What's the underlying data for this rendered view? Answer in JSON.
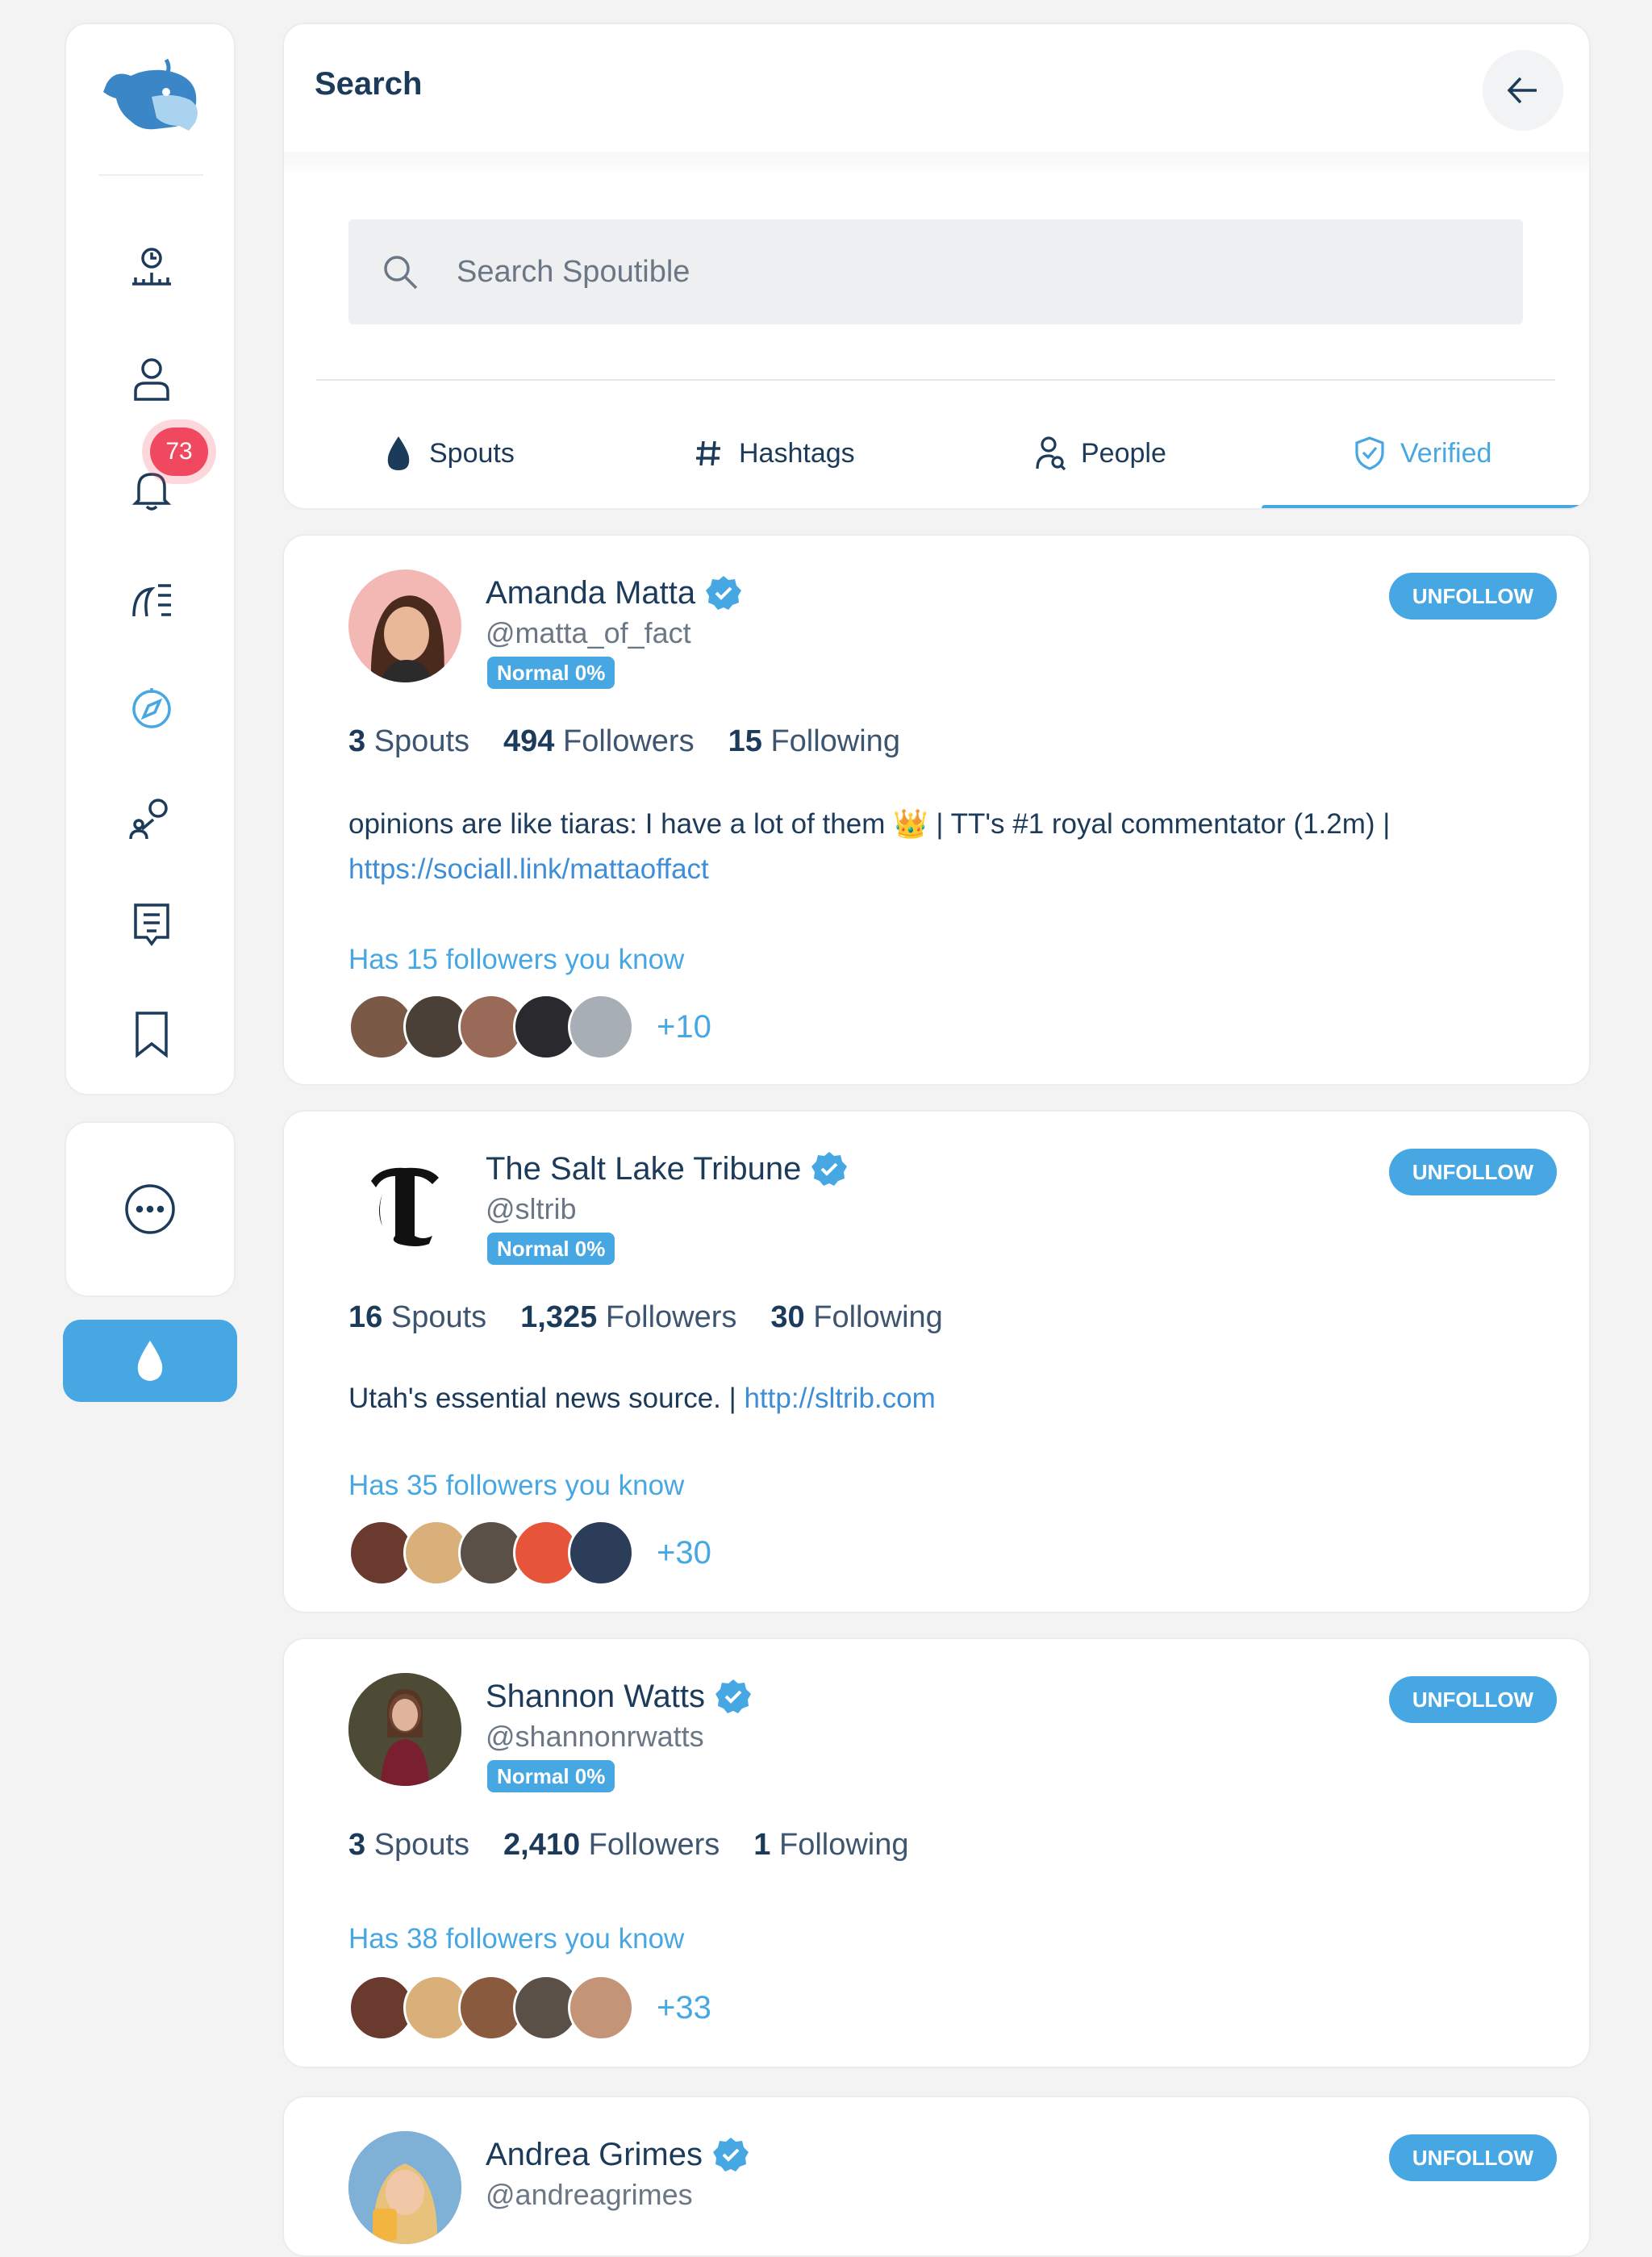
{
  "sidebar": {
    "notifications_count": "73",
    "icons": [
      "timeline-icon",
      "profile-icon",
      "notifications-icon",
      "discover-icon",
      "explore-icon",
      "groups-icon",
      "articles-icon",
      "bookmark-icon"
    ]
  },
  "search": {
    "title": "Search",
    "placeholder": "Search Spoutible",
    "tabs": [
      {
        "label": "Spouts",
        "icon": "drop-icon",
        "active": false
      },
      {
        "label": "Hashtags",
        "icon": "hashtag-icon",
        "active": false
      },
      {
        "label": "People",
        "icon": "people-search-icon",
        "active": false
      },
      {
        "label": "Verified",
        "icon": "shield-check-icon",
        "active": true
      }
    ]
  },
  "colors": {
    "accent": "#47a7e3",
    "text": "#1c3a5a",
    "badge": "#f0485f"
  },
  "users": [
    {
      "name": "Amanda Matta",
      "handle": "@matta_of_fact",
      "mood": "Normal 0%",
      "follow_label": "UNFOLLOW",
      "spouts": "3",
      "spouts_label": "Spouts",
      "followers": "494",
      "followers_label": "Followers",
      "following": "15",
      "following_label": "Following",
      "bio": "opinions are like tiaras: I have a lot of them 👑 | TT's #1 royal commentator (1.2m) |",
      "bio_link": "https://sociall.link/mattaoffact",
      "known": "Has 15 followers you know",
      "known_more": "+10"
    },
    {
      "name": "The Salt Lake Tribune",
      "handle": "@sltrib",
      "mood": "Normal 0%",
      "follow_label": "UNFOLLOW",
      "spouts": "16",
      "spouts_label": "Spouts",
      "followers": "1,325",
      "followers_label": "Followers",
      "following": "30",
      "following_label": "Following",
      "bio": "Utah's essential news source. |",
      "bio_link": "http://sltrib.com",
      "known": "Has 35 followers you know",
      "known_more": "+30"
    },
    {
      "name": "Shannon Watts",
      "handle": "@shannonrwatts",
      "mood": "Normal 0%",
      "follow_label": "UNFOLLOW",
      "spouts": "3",
      "spouts_label": "Spouts",
      "followers": "2,410",
      "followers_label": "Followers",
      "following": "1",
      "following_label": "Following",
      "known": "Has 38 followers you know",
      "known_more": "+33"
    },
    {
      "name": "Andrea Grimes",
      "handle": "@andreagrimes",
      "follow_label": "UNFOLLOW"
    }
  ]
}
